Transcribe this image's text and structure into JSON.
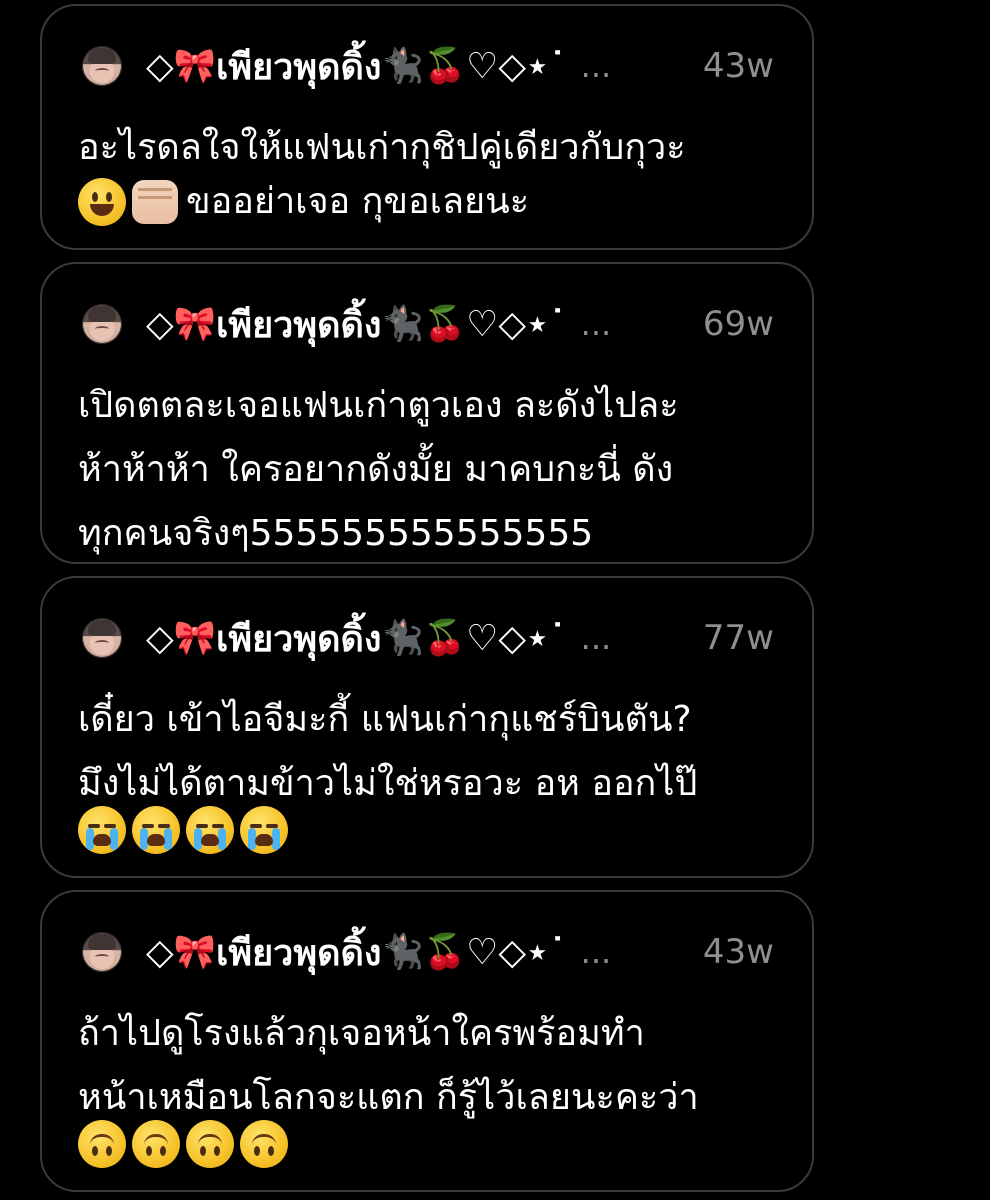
{
  "posts": [
    {
      "username": "◇🎀เพียวพุดดิ้ง🐈‍⬛🍒♡◇⋆˙",
      "name_prefix": "◇",
      "name_bow": "🎀",
      "name_text": "เพียวพุดดิ้ง",
      "name_cat": "🐈‍⬛",
      "name_cherry": "🍒",
      "name_suffix": "♡◇⋆˙",
      "ellipsis": "...",
      "time": "43w",
      "body_line1": "อะไรดลใจให้แฟนเก่ากุชิปคู่เดียวกับกุวะ",
      "body_line2_text": "ขออย่าเจอ กุขอเลยนะ",
      "emojis": [
        "grinning-face",
        "oncoming-fist"
      ]
    },
    {
      "username": "◇🎀เพียวพุดดิ้ง🐈‍⬛🍒♡◇⋆˙",
      "name_prefix": "◇",
      "name_bow": "🎀",
      "name_text": "เพียวพุดดิ้ง",
      "name_cat": "🐈‍⬛",
      "name_cherry": "🍒",
      "name_suffix": "♡◇⋆˙",
      "ellipsis": "...",
      "time": "69w",
      "body": "เปิดตตละเจอแฟนเก่าตูวเอง ละดังไปละ\nห้าห้าห้า ใครอยากดังมั้ย มาคบกะนี่ ดัง\nทุกคนจริงๆ555555555555555"
    },
    {
      "username": "◇🎀เพียวพุดดิ้ง🐈‍⬛🍒♡◇⋆˙",
      "name_prefix": "◇",
      "name_bow": "🎀",
      "name_text": "เพียวพุดดิ้ง",
      "name_cat": "🐈‍⬛",
      "name_cherry": "🍒",
      "name_suffix": "♡◇⋆˙",
      "ellipsis": "...",
      "time": "77w",
      "body": "เดี๋ยว เข้าไอจีมะกี้ แฟนเก่ากุแชร์บินตัน?\nมึงไม่ได้ตามข้าวไม่ใช่หรอวะ อห ออกไป๊",
      "emojis": [
        "loudly-crying-face",
        "loudly-crying-face",
        "loudly-crying-face",
        "loudly-crying-face"
      ]
    },
    {
      "username": "◇🎀เพียวพุดดิ้ง🐈‍⬛🍒♡◇⋆˙",
      "name_prefix": "◇",
      "name_bow": "🎀",
      "name_text": "เพียวพุดดิ้ง",
      "name_cat": "🐈‍⬛",
      "name_cherry": "🍒",
      "name_suffix": "♡◇⋆˙",
      "ellipsis": "...",
      "time": "43w",
      "body": "ถ้าไปดูโรงแล้วกุเจอหน้าใครพร้อมทำ\nหน้าเหมือนโลกจะแตก ก็รู้ไว้เลยนะคะว่า",
      "emojis": [
        "upside-down-face",
        "upside-down-face",
        "upside-down-face",
        "upside-down-face"
      ]
    }
  ],
  "colors": {
    "background": "#000000",
    "card_border": "#3a3a3e",
    "text_primary": "#ffffff",
    "text_secondary": "#8e8e93"
  }
}
